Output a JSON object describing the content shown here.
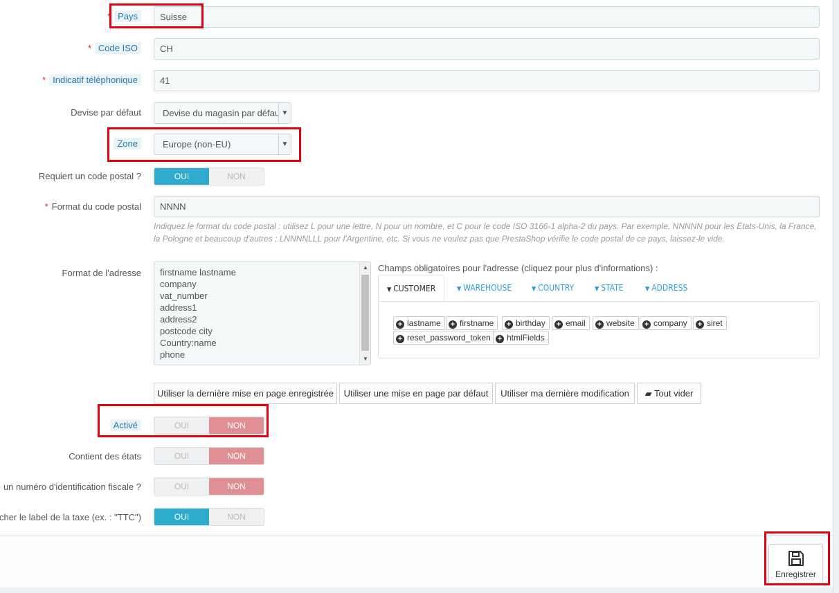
{
  "form": {
    "country": {
      "label": "Pays",
      "value": "Suisse"
    },
    "iso": {
      "label": "Code ISO",
      "value": "CH"
    },
    "phone_prefix": {
      "label": "Indicatif téléphonique",
      "value": "41"
    },
    "currency": {
      "label": "Devise par défaut",
      "value": "Devise du magasin par défaut"
    },
    "zone": {
      "label": "Zone",
      "value": "Europe (non-EU)"
    },
    "zip_required": {
      "label": "Requiert un code postal ?",
      "yes": "OUI",
      "no": "NON",
      "state": "yes"
    },
    "zip_format": {
      "label": "Format du code postal",
      "value": "NNNN",
      "help": "Indiquez le format du code postal : utilisez L pour une lettre, N pour un nombre, et C pour le code ISO 3166-1 alpha-2 du pays. Par exemple, NNNNN pour les États-Unis, la France, la Pologne et beaucoup d'autres ; LNNNNLLL pour l'Argentine, etc. Si vous ne voulez pas que PrestaShop vérifie le code postal de ce pays, laissez-le vide."
    },
    "address_format": {
      "label": "Format de l'adresse",
      "lines": [
        "firstname lastname",
        "company",
        "vat_number",
        "address1",
        "address2",
        "postcode city",
        "Country:name",
        "phone"
      ]
    },
    "required_fields": {
      "title": "Champs obligatoires pour l'adresse (cliquez pour plus d'informations) :",
      "tabs": [
        "CUSTOMER",
        "WAREHOUSE",
        "COUNTRY",
        "STATE",
        "ADDRESS"
      ],
      "chips": [
        "lastname",
        "firstname",
        "birthday",
        "email",
        "website",
        "company",
        "siret",
        "reset_password_token",
        "htmlFields"
      ]
    },
    "buttons": {
      "last_saved": "Utiliser la dernière mise en page enregistrée",
      "default_layout": "Utiliser une mise en page par défaut",
      "last_modification": "Utiliser ma dernière modification",
      "clear_all": "Tout vider"
    },
    "active": {
      "label": "Activé",
      "yes": "OUI",
      "no": "NON",
      "state": "no"
    },
    "contains_states": {
      "label": "Contient des états",
      "yes": "OUI",
      "no": "NON",
      "state": "no"
    },
    "tax_id": {
      "label": "un numéro d'identification fiscale ?",
      "yes": "OUI",
      "no": "NON",
      "state": "no"
    },
    "tax_label": {
      "label": "ficher le label de la taxe (ex. : \"TTC\")",
      "yes": "OUI",
      "no": "NON",
      "state": "yes"
    }
  },
  "footer": {
    "save_label": "Enregistrer"
  },
  "colors": {
    "accent": "#2eacce",
    "no_active": "#e08f95",
    "required": "#e0232e",
    "highlight": "#e3000f"
  }
}
